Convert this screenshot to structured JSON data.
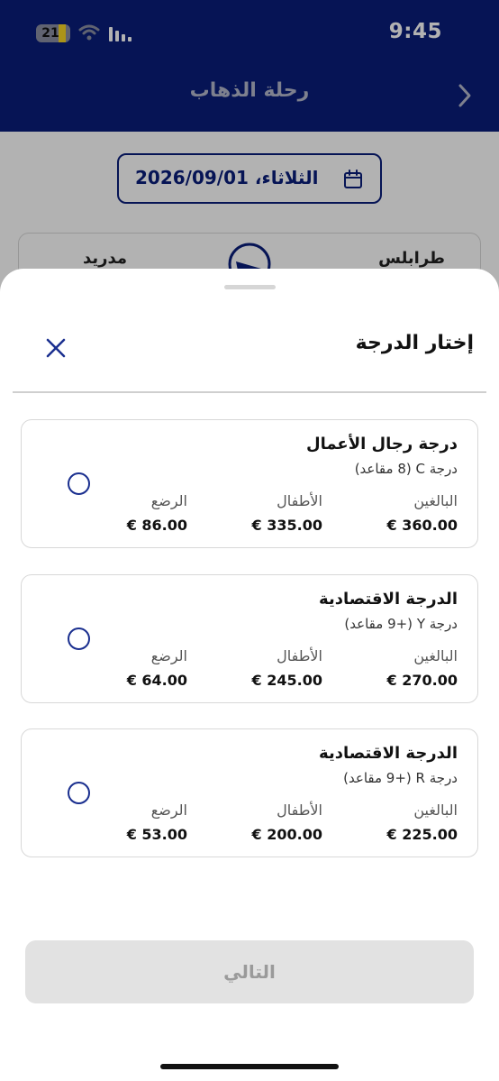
{
  "status_bar": {
    "time": "9:45",
    "battery_level": "21",
    "battery_fraction": 0.21
  },
  "header": {
    "title": "رحلة الذهاب",
    "back_icon": "chevron-right-icon"
  },
  "date_selector": {
    "label": "الثلاثاء، 2026/09/01",
    "icon": "calendar-icon"
  },
  "route": {
    "from": "طرابلس",
    "to": "مدريد",
    "icon": "plane-icon"
  },
  "sheet": {
    "title": "إختار الدرجة",
    "close_icon": "close-icon",
    "fare_options": [
      {
        "name": "درجة رجال الأعمال",
        "subtitle": "درجة C (8 مقاعد)",
        "prices": [
          {
            "label": "البالغين",
            "value": "€ 360.00"
          },
          {
            "label": "الأطفال",
            "value": "€ 335.00"
          },
          {
            "label": "الرضع",
            "value": "€ 86.00"
          }
        ],
        "selected": false
      },
      {
        "name": "الدرجة الاقتصادية",
        "subtitle": "درجة Y (+9 مقاعد)",
        "prices": [
          {
            "label": "البالغين",
            "value": "€ 270.00"
          },
          {
            "label": "الأطفال",
            "value": "€ 245.00"
          },
          {
            "label": "الرضع",
            "value": "€ 64.00"
          }
        ],
        "selected": false
      },
      {
        "name": "الدرجة الاقتصادية",
        "subtitle": "درجة R (+9 مقاعد)",
        "prices": [
          {
            "label": "البالغين",
            "value": "€ 225.00"
          },
          {
            "label": "الأطفال",
            "value": "€ 200.00"
          },
          {
            "label": "الرضع",
            "value": "€ 53.00"
          }
        ],
        "selected": false
      }
    ],
    "next_label": "التالي"
  },
  "colors": {
    "brand_navy": "#0a1e7a",
    "radio_blue": "#1a2f8f",
    "disabled_button": "#e2e2e2",
    "battery_yellow": "#f5d524"
  }
}
